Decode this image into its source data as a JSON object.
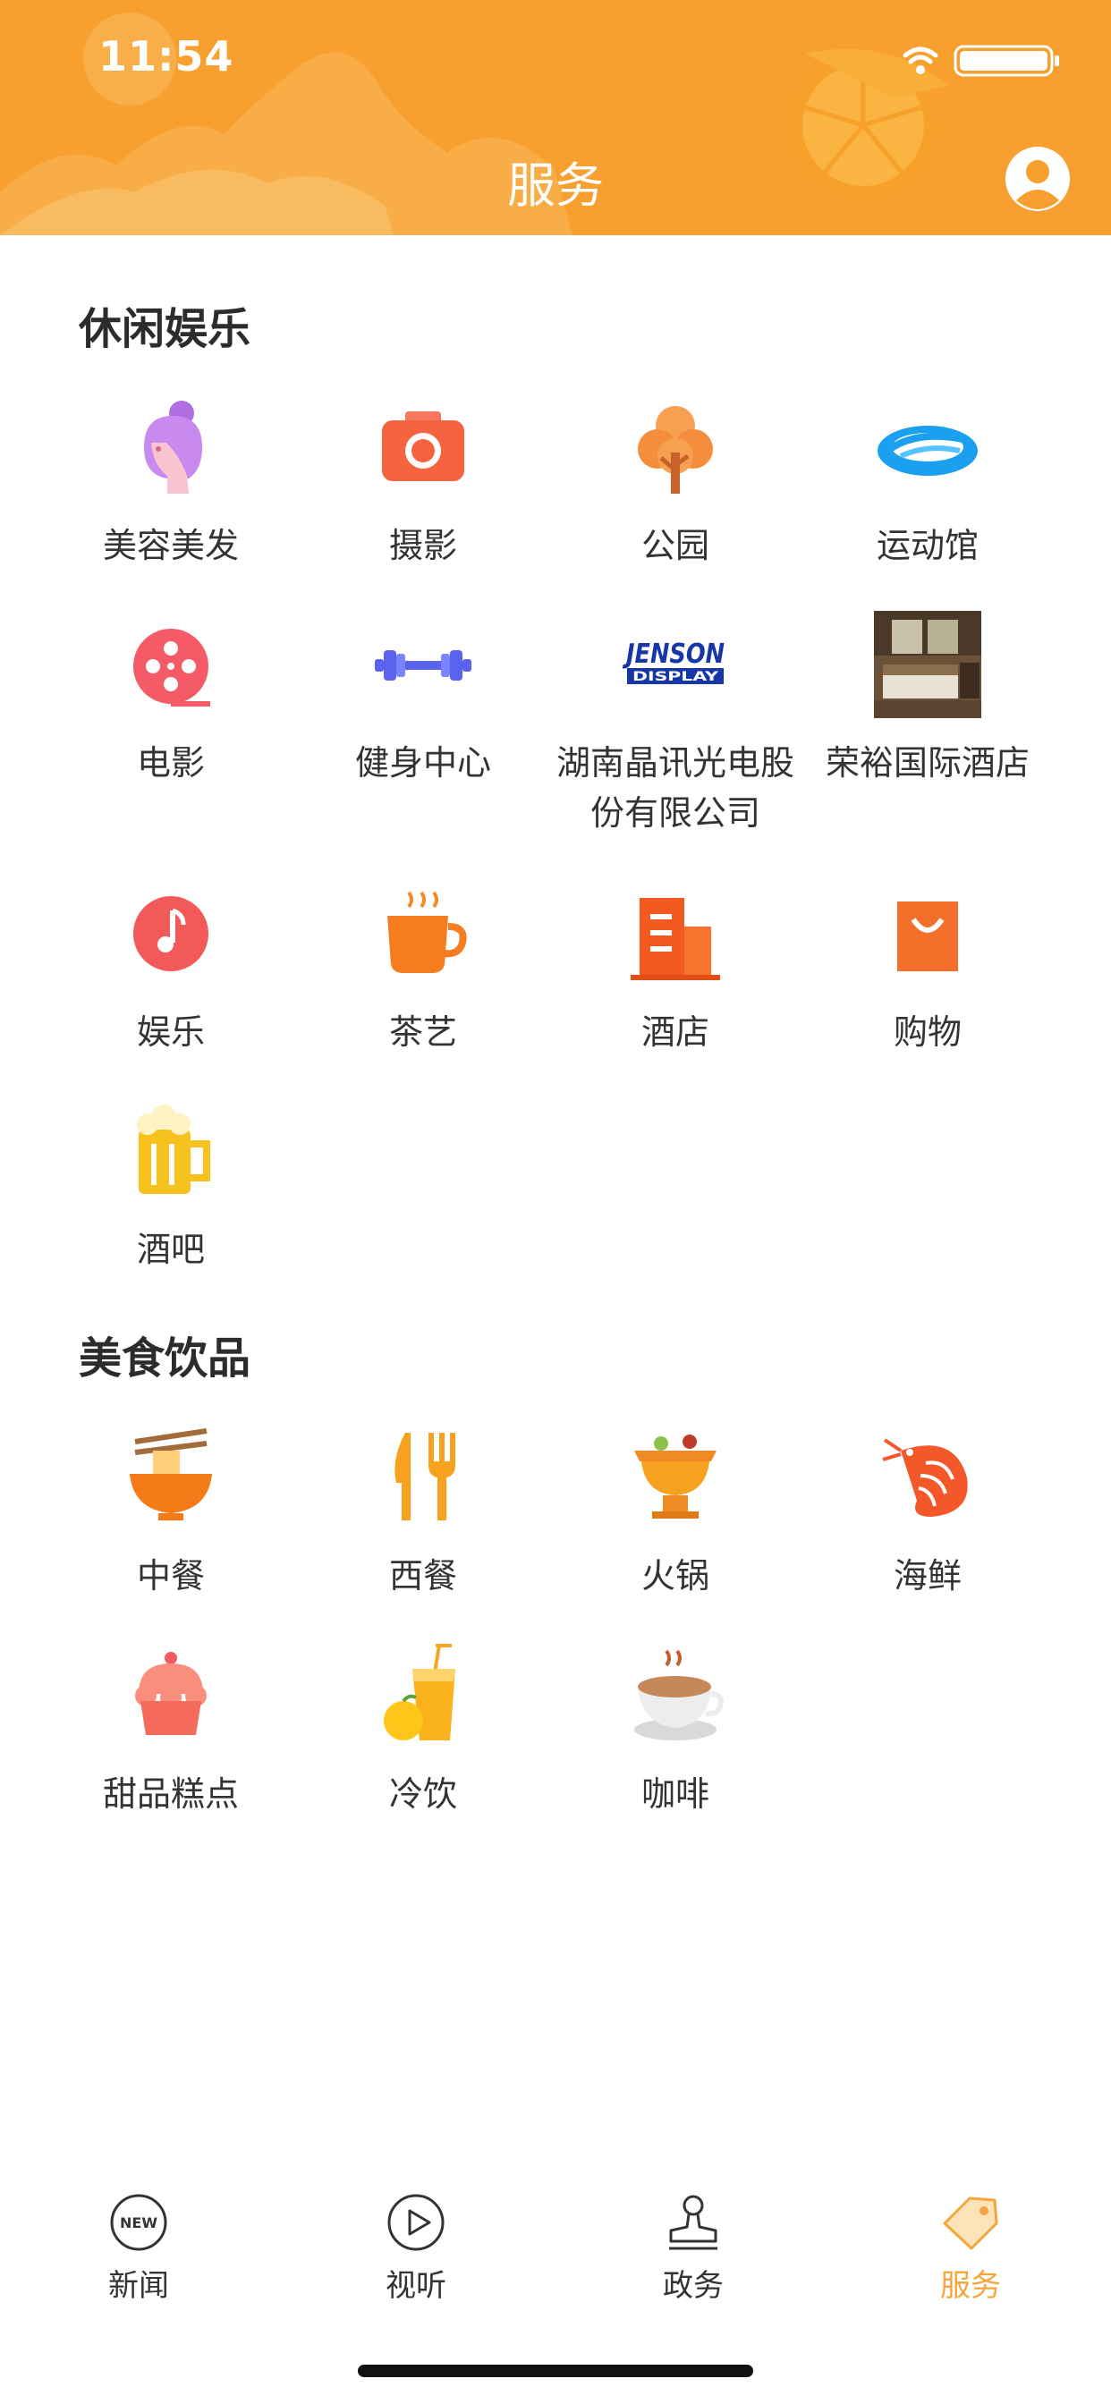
{
  "status_bar": {
    "time": "11:54"
  },
  "header": {
    "title": "服务"
  },
  "sections": [
    {
      "title": "休闲娱乐",
      "items": [
        {
          "label": "美容美发",
          "icon": "beauty-salon-icon"
        },
        {
          "label": "摄影",
          "icon": "camera-icon"
        },
        {
          "label": "公园",
          "icon": "tree-icon"
        },
        {
          "label": "运动馆",
          "icon": "stadium-icon"
        },
        {
          "label": "电影",
          "icon": "film-reel-icon"
        },
        {
          "label": "健身中心",
          "icon": "dumbbell-icon"
        },
        {
          "label": "湖南晶讯光电股份有限公司",
          "icon": "jenson-display-logo",
          "logo_text": "JENSON DISPLAY"
        },
        {
          "label": "荣裕国际酒店",
          "icon": "hotel-room-photo"
        },
        {
          "label": "娱乐",
          "icon": "music-note-icon"
        },
        {
          "label": "茶艺",
          "icon": "tea-cup-icon"
        },
        {
          "label": "酒店",
          "icon": "hotel-building-icon"
        },
        {
          "label": "购物",
          "icon": "shopping-bag-icon"
        },
        {
          "label": "酒吧",
          "icon": "beer-mug-icon"
        }
      ]
    },
    {
      "title": "美食饮品",
      "items": [
        {
          "label": "中餐",
          "icon": "noodle-bowl-icon"
        },
        {
          "label": "西餐",
          "icon": "knife-fork-icon"
        },
        {
          "label": "火锅",
          "icon": "hotpot-icon"
        },
        {
          "label": "海鲜",
          "icon": "shrimp-icon"
        },
        {
          "label": "甜品糕点",
          "icon": "cupcake-icon"
        },
        {
          "label": "冷饮",
          "icon": "juice-icon"
        },
        {
          "label": "咖啡",
          "icon": "coffee-cup-icon"
        }
      ]
    }
  ],
  "tabbar": {
    "tabs": [
      {
        "label": "新闻",
        "icon": "news-icon",
        "badge": "NEW"
      },
      {
        "label": "视听",
        "icon": "play-icon"
      },
      {
        "label": "政务",
        "icon": "stamp-icon"
      },
      {
        "label": "服务",
        "icon": "tag-icon",
        "active": true
      }
    ],
    "accent_color": "#f4a63c"
  },
  "colors": {
    "header": "#f7a030",
    "text": "#333333"
  }
}
